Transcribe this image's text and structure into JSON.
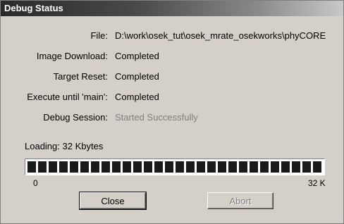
{
  "window": {
    "title": "Debug Status"
  },
  "fields": [
    {
      "label": "File:",
      "value": "D:\\work\\osek_tut\\osek_mrate_osekworks\\phyCORE",
      "disabled": false
    },
    {
      "label": "Image Download:",
      "value": "Completed",
      "disabled": false
    },
    {
      "label": "Target Reset:",
      "value": "Completed",
      "disabled": false
    },
    {
      "label": "Execute until 'main':",
      "value": "Completed",
      "disabled": false
    },
    {
      "label": "Debug Session:",
      "value": "Started Successfully",
      "disabled": true
    }
  ],
  "loading": {
    "label": "Loading:",
    "amount": "32 Kbytes",
    "progress_fraction": 1.0,
    "scale_min": "0",
    "scale_max": "32 K"
  },
  "buttons": {
    "close_label": "Close",
    "abort_label": "Abort"
  },
  "colors": {
    "dialog_bg": "#d4d0c8",
    "disabled_text": "#808080",
    "progress_block": "#1a1a1a"
  }
}
